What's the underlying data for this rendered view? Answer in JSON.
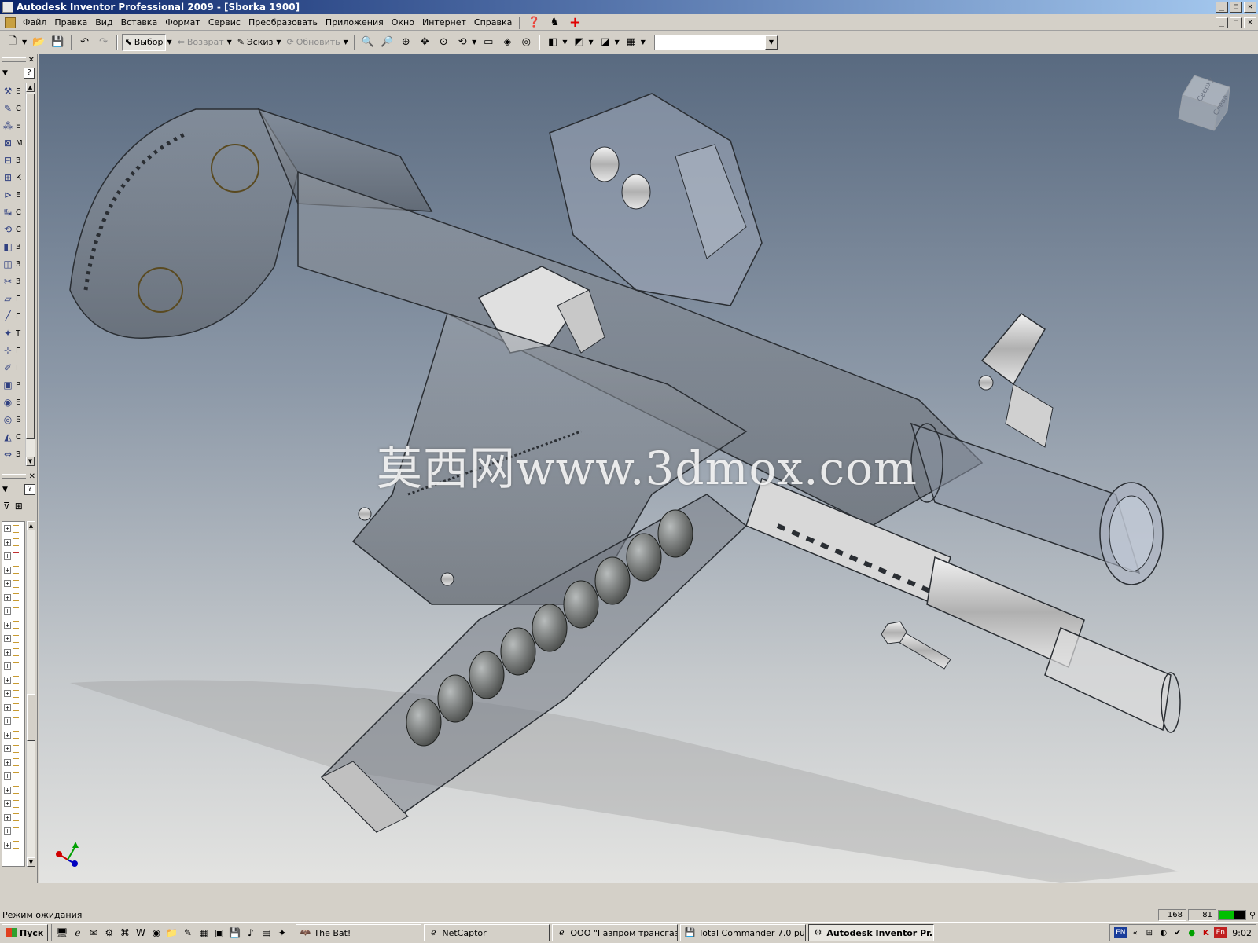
{
  "window": {
    "title": "Autodesk Inventor Professional 2009 - [Sborka 1900]"
  },
  "menu": {
    "items": [
      "Файл",
      "Правка",
      "Вид",
      "Вставка",
      "Формат",
      "Сервис",
      "Преобразовать",
      "Приложения",
      "Окно",
      "Интернет",
      "Справка"
    ]
  },
  "toolbar": {
    "select_label": "Выбор",
    "return_label": "Возврат",
    "sketch_label": "Эскиз",
    "update_label": "Обновить",
    "combo_value": ""
  },
  "left_panel": {
    "tools": [
      {
        "icon": "place-component-icon",
        "label": "Е"
      },
      {
        "icon": "create-component-icon",
        "label": "С"
      },
      {
        "icon": "pattern-icon",
        "label": "Е"
      },
      {
        "icon": "constraint-icon",
        "label": "М"
      },
      {
        "icon": "assemble-icon",
        "label": "З"
      },
      {
        "icon": "bolt-icon",
        "label": "К"
      },
      {
        "icon": "replace-icon",
        "label": "Е"
      },
      {
        "icon": "move-icon",
        "label": "С"
      },
      {
        "icon": "rotate-icon",
        "label": "С"
      },
      {
        "icon": "section-icon",
        "label": "З"
      },
      {
        "icon": "split-icon",
        "label": "З"
      },
      {
        "icon": "analyze-icon",
        "label": "З"
      },
      {
        "icon": "plane-icon",
        "label": "Г"
      },
      {
        "icon": "axis-icon",
        "label": "Г"
      },
      {
        "icon": "point-icon",
        "label": "Т"
      },
      {
        "icon": "ucs-icon",
        "label": "Г"
      },
      {
        "icon": "sketch-icon",
        "label": "Г"
      },
      {
        "icon": "extrude-icon",
        "label": "Р"
      },
      {
        "icon": "revolve-icon",
        "label": "Е"
      },
      {
        "icon": "hole-icon",
        "label": "Б"
      },
      {
        "icon": "chamfer-icon",
        "label": "С"
      },
      {
        "icon": "mirror-icon",
        "label": "З"
      }
    ]
  },
  "status": {
    "text": "Режим ожидания",
    "cell1": "168",
    "cell2": "81",
    "progress_fraction": 0.55
  },
  "taskbar": {
    "start_label": "Пуск",
    "tasks": [
      {
        "label": "The Bat!",
        "active": false
      },
      {
        "label": "NetCaptor",
        "active": false
      },
      {
        "label": "ООО \"Газпром трансгаз...",
        "active": false
      },
      {
        "label": "Total Commander 7.0 pu...",
        "active": false
      },
      {
        "label": "Autodesk Inventor Pr...",
        "active": true
      }
    ],
    "lang1": "EN",
    "lang2": "En",
    "clock": "9:02"
  },
  "viewport": {
    "watermark": "莫西网www.3dmox.com",
    "viewcube_top": "Сверху",
    "viewcube_left": "Слева"
  }
}
